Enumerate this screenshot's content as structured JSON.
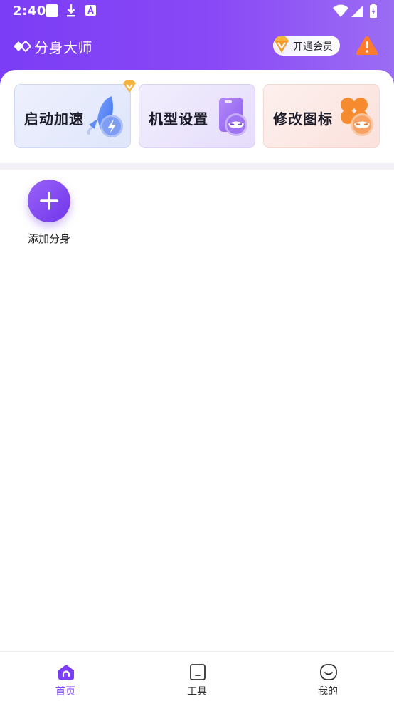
{
  "status_bar": {
    "time": "2:40"
  },
  "header": {
    "app_title": "分身大师",
    "vip_button_label": "开通会员"
  },
  "features": [
    {
      "label": "启动加速",
      "icon": "rocket-icon",
      "vip": true
    },
    {
      "label": "机型设置",
      "icon": "phone-mask-icon",
      "vip": false
    },
    {
      "label": "修改图标",
      "icon": "clover-mask-icon",
      "vip": false
    }
  ],
  "add_clone": {
    "label": "添加分身"
  },
  "bottom_nav": {
    "items": [
      {
        "label": "首页",
        "icon": "home-icon",
        "active": true
      },
      {
        "label": "工具",
        "icon": "tablet-icon",
        "active": false
      },
      {
        "label": "我的",
        "icon": "smile-icon",
        "active": false
      }
    ]
  },
  "colors": {
    "brand_purple": "#7b3df5",
    "accent_orange": "#f6a33a",
    "warning_orange": "#ff7a2a"
  }
}
